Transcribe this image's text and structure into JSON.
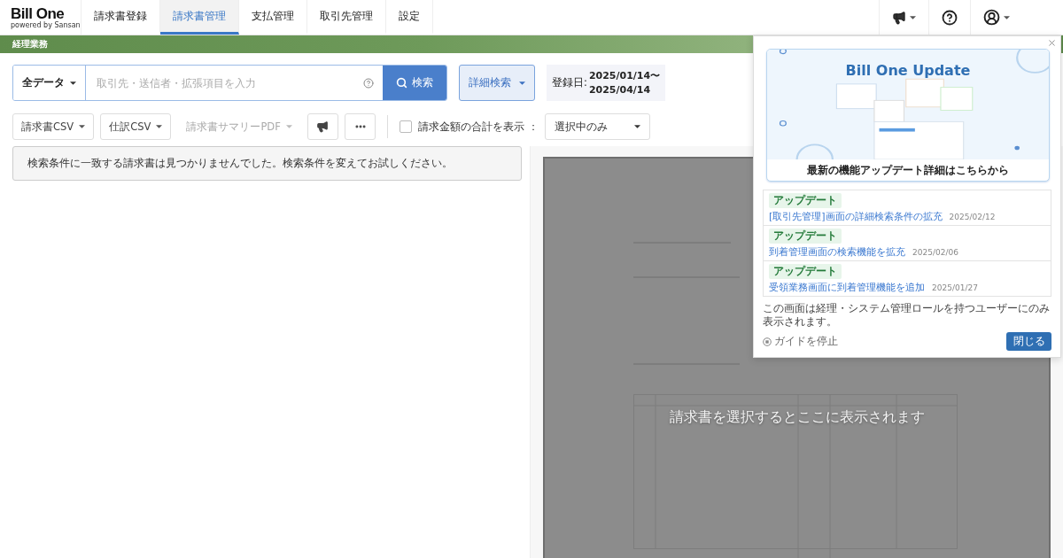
{
  "logo": {
    "name": "Bill One",
    "tagline": "powered by Sansan"
  },
  "nav_tabs": [
    {
      "label": "請求書登録",
      "selected": false
    },
    {
      "label": "請求書管理",
      "selected": true
    },
    {
      "label": "支払管理",
      "selected": false
    },
    {
      "label": "取引先管理",
      "selected": false
    },
    {
      "label": "設定",
      "selected": false
    }
  ],
  "section_band": {
    "title": "経理業務"
  },
  "search": {
    "scope": "全データ",
    "placeholder": "取引先・送信者・拡張項目を入力",
    "button": "検索",
    "advanced": "詳細検索",
    "date_label": "登録日:",
    "date_from": "2025/01/14〜",
    "date_to": "2025/04/14"
  },
  "toolbar": {
    "buttons": [
      {
        "label": "請求書CSV",
        "disabled": false
      },
      {
        "label": "仕訳CSV",
        "disabled": false
      },
      {
        "label": "請求書サマリーPDF",
        "disabled": true
      }
    ],
    "total_checkbox": {
      "label": "請求金額の合計を表示 ：",
      "checked": false
    },
    "total_scope": "選択中のみ"
  },
  "empty_message": "検索条件に一致する請求書は見つかりませんでした。検索条件を変えてお試しください。",
  "preview": {
    "hint": "請求書を選択するとここに表示されます"
  },
  "update_popup": {
    "banner_title": "Bill One Update",
    "banner_caption": "最新の機能アップデート詳細はこちらから",
    "items": [
      {
        "tag": "アップデート",
        "title": "[取引先管理]画面の詳細検索条件の拡充",
        "date": "2025/02/12"
      },
      {
        "tag": "アップデート",
        "title": "到着管理画面の検索機能を拡充",
        "date": "2025/02/06"
      },
      {
        "tag": "アップデート",
        "title": "受領業務画面に到着管理機能を追加",
        "date": "2025/01/27"
      }
    ],
    "note": "この画面は経理・システム管理ロールを持つユーザーにのみ表示されます。",
    "stop_guide": "ガイドを停止",
    "close": "閉じる"
  }
}
